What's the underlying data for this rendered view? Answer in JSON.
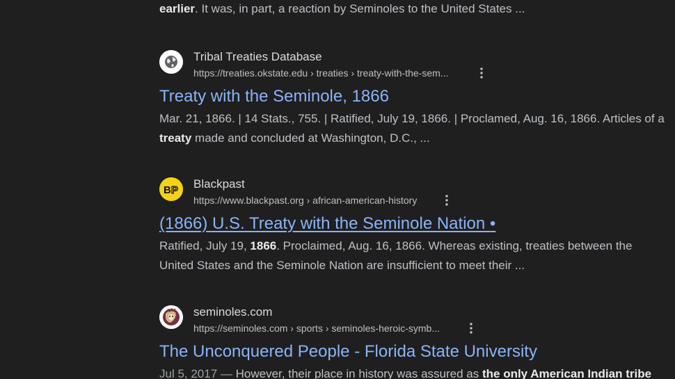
{
  "top_snippet": {
    "bold": "earlier",
    "rest": ". It was, in part, a reaction by Seminoles to the United States ..."
  },
  "results": [
    {
      "site_name": "Tribal Treaties Database",
      "url": "https://treaties.okstate.edu › treaties › treaty-with-the-sem...",
      "favicon": "globe-icon",
      "title": "Treaty with the Seminole, 1866",
      "snippet_line1": "Mar. 21, 1866. | 14 Stats., 755. | Ratified, July 19, 1866. | Proclamed, Aug. 16, 1866. Articles of a",
      "snippet_line2_bold": "treaty",
      "snippet_line2_rest": " made and concluded at Washington, D.C., ..."
    },
    {
      "site_name": "Blackpast",
      "url": "https://www.blackpast.org › african-american-history",
      "favicon": "blackpast-logo-icon",
      "favicon_text": "BP",
      "title": "(1866) U.S. Treaty with the Seminole Nation •",
      "snippet_line1_pre": "Ratified, July 19, ",
      "snippet_line1_bold": "1866",
      "snippet_line1_post": ". Proclaimed, Aug. 16, 1866. Whereas existing, treaties between the",
      "snippet_line2": "United States and the Seminole Nation are insufficient to meet their ..."
    },
    {
      "site_name": "seminoles.com",
      "url": "https://seminoles.com › sports › seminoles-heroic-symb...",
      "favicon": "seminoles-logo-icon",
      "title": "The Unconquered People - Florida State University",
      "snippet_date": "Jul 5, 2017",
      "snippet_sep": " — ",
      "snippet_rest": "However, their place in history was assured as ",
      "snippet_bold": "the only American Indian tribe"
    }
  ],
  "colors": {
    "background": "#1f1f1f",
    "link": "#8ab4f8",
    "text": "#bdc1c6",
    "site_name": "#dadce0"
  }
}
